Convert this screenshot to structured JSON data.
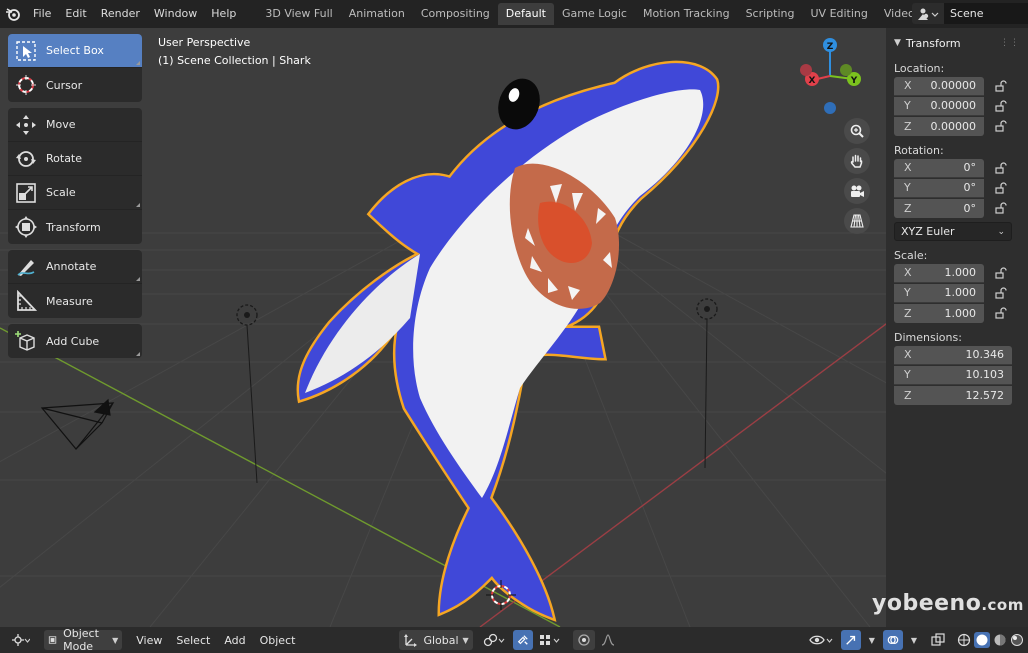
{
  "topbar": {
    "menus": [
      "File",
      "Edit",
      "Render",
      "Window",
      "Help"
    ],
    "workspaces": [
      "3D View Full",
      "Animation",
      "Compositing",
      "Default",
      "Game Logic",
      "Motion Tracking",
      "Scripting",
      "UV Editing",
      "Video Editing"
    ],
    "active_workspace": "Default",
    "scene_name": "Scene"
  },
  "viewport": {
    "perspective_label": "User Perspective",
    "collection_label": "(1) Scene Collection | Shark"
  },
  "toolbar": {
    "select_box": "Select Box",
    "cursor": "Cursor",
    "move": "Move",
    "rotate": "Rotate",
    "scale": "Scale",
    "transform": "Transform",
    "annotate": "Annotate",
    "measure": "Measure",
    "add_cube": "Add Cube"
  },
  "gizmo": {
    "z": "Z",
    "x": "X",
    "y": "Y"
  },
  "properties": {
    "panel_title": "Transform",
    "location_label": "Location:",
    "location": {
      "x": "0.00000",
      "y": "0.00000",
      "z": "0.00000"
    },
    "rotation_label": "Rotation:",
    "rotation": {
      "x": "0°",
      "y": "0°",
      "z": "0°"
    },
    "rotation_mode": "XYZ Euler",
    "scale_label": "Scale:",
    "scale": {
      "x": "1.000",
      "y": "1.000",
      "z": "1.000"
    },
    "dimensions_label": "Dimensions:",
    "dimensions": {
      "x": "10.346",
      "y": "10.103",
      "z": "12.572"
    },
    "axis_x": "X",
    "axis_y": "Y",
    "axis_z": "Z"
  },
  "bottombar": {
    "mode": "Object Mode",
    "view": "View",
    "select": "Select",
    "add": "Add",
    "object": "Object",
    "orientation": "Global"
  },
  "watermark": {
    "name": "yobeeno",
    "suffix": ".com"
  },
  "colors": {
    "accent": "#5680c2",
    "selection_outline": "#f5a623",
    "shark_blue": "#4048d8",
    "axis_x": "#e0404a",
    "axis_y": "#7bc21e",
    "axis_z": "#2f8fe0"
  }
}
